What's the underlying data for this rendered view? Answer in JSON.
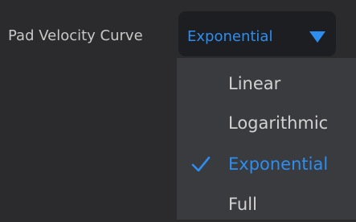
{
  "setting": {
    "label": "Pad Velocity Curve"
  },
  "select": {
    "value": "Exponential",
    "arrow_icon": "triangle-down-icon"
  },
  "dropdown": {
    "options": [
      {
        "label": "Linear",
        "selected": false
      },
      {
        "label": "Logarithmic",
        "selected": false
      },
      {
        "label": "Exponential",
        "selected": true
      },
      {
        "label": "Full",
        "selected": false
      }
    ],
    "check_icon": "checkmark-icon"
  },
  "colors": {
    "accent": "#2e8ef0",
    "background": "#2b2b2d",
    "select_background": "#1c1e22",
    "menu_background": "#3a3b3f",
    "text": "#d2d2d2"
  }
}
